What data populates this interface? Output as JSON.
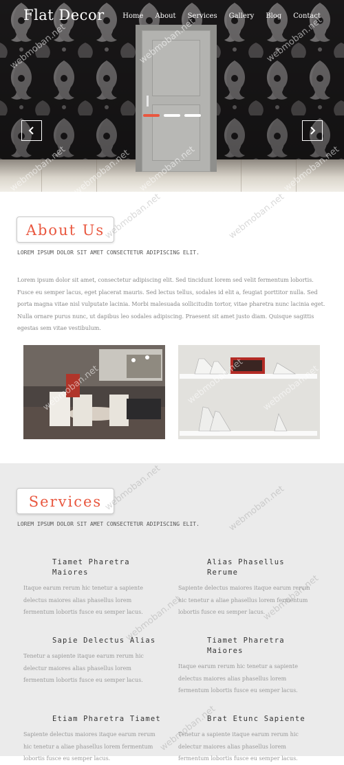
{
  "header": {
    "brand": "Flat Decor",
    "nav": [
      "Home",
      "About",
      "Services",
      "Gallery",
      "Blog",
      "Contact"
    ]
  },
  "slider": {
    "slide_count": 3,
    "active_slide": 1,
    "prev_icon": "chevron-left-icon",
    "next_icon": "chevron-right-icon"
  },
  "watermark": "webmoban.net",
  "about": {
    "title": "About Us",
    "tagline": "LOREM IPSUM DOLOR SIT AMET CONSECTETUR ADIPISCING ELIT.",
    "body": "Lorem ipsum dolor sit amet, consectetur adipiscing elit. Sed tincidunt lorem sed velit fermentum lobortis. Fusce eu semper lacus, eget placerat mauris. Sed lectus tellus, sodales id elit a, feugiat porttitor nulla. Sed porta magna vitae nisl vulputate lacinia. Morbi malesuada sollicitudin tortor, vitae pharetra nunc lacinia eget. Nulla ornare purus nunc, ut dapibus leo sodales adipiscing. Praesent sit amet justo diam. Quisque sagittis egestas sem vitae vestibulum."
  },
  "services": {
    "title": "Services",
    "tagline": "LOREM IPSUM DOLOR SIT AMET CONSECTETUR ADIPISCING ELIT.",
    "items": [
      {
        "title": "Tiamet Pharetra Maiores",
        "desc": "Itaque earum rerum hic tenetur a sapiente delectus maiores alias phasellus lorem fermentum lobortis fusce eu semper lacus."
      },
      {
        "title": "Alias Phasellus Rerume",
        "desc": "Sapiente delectus maiores itaque earum rerum hic tenetur a aliae phasellus lorem fermentum lobortis fusce eu semper lacus."
      },
      {
        "title": "Sapie Delectus Alias",
        "desc": "Tenetur a sapiente itaque earum rerum hic delectur maiores alias phasellus lorem fermentum lobortis fusce eu semper lacus."
      },
      {
        "title": "Tiamet Pharetra Maiores",
        "desc": "Itaque earum rerum hic tenetur a sapiente delectus maiores alias phasellus lorem fermentum lobortis fusce eu semper lacus."
      },
      {
        "title": "Etiam Pharetra Tiamet",
        "desc": "Sapiente delectus maiores itaque earum rerum hic tenetur a aliae phasellus lorem fermentum lobortis fusce eu semper lacus."
      },
      {
        "title": "Brat Etunc Sapiente",
        "desc": "Tenetur a sapiente itaque earum rerum hic delectur maiores alias phasellus lorem fermentum lobortis fusce eu semper lacus."
      }
    ]
  }
}
